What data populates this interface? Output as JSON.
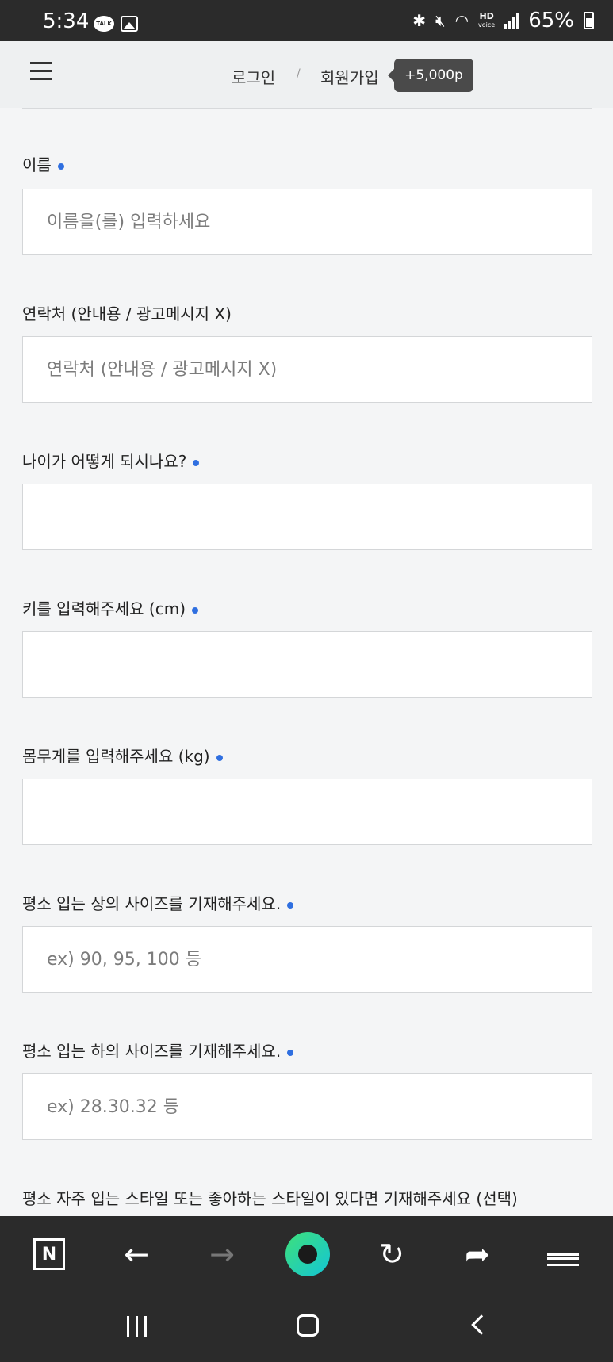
{
  "status_bar": {
    "time": "5:34",
    "talk_icon": "TALK",
    "hd_label": "HD",
    "voice_label": "voice",
    "battery": "65%"
  },
  "header": {
    "login": "로그인",
    "separator": "/",
    "signup": "회원가입",
    "points": "+5,000p"
  },
  "form": {
    "fields": [
      {
        "label": "이름",
        "required": true,
        "placeholder": "이름을(를) 입력하세요",
        "value": ""
      },
      {
        "label": "연락처 (안내용 / 광고메시지 X)",
        "required": false,
        "placeholder": "연락처 (안내용 / 광고메시지 X)",
        "value": ""
      },
      {
        "label": "나이가 어떻게 되시나요?",
        "required": true,
        "placeholder": "",
        "value": ""
      },
      {
        "label": "키를 입력해주세요 (cm)",
        "required": true,
        "placeholder": "",
        "value": ""
      },
      {
        "label": "몸무게를 입력해주세요 (kg)",
        "required": true,
        "placeholder": "",
        "value": ""
      },
      {
        "label": "평소 입는 상의 사이즈를 기재해주세요.",
        "required": true,
        "placeholder": "ex) 90, 95, 100 등",
        "value": ""
      },
      {
        "label": "평소 입는 하의 사이즈를 기재해주세요.",
        "required": true,
        "placeholder": "ex) 28.30.32 등",
        "value": ""
      }
    ],
    "last_label": "평소 자주 입는 스타일 또는 좋아하는 스타일이 있다면 기재해주세요 (선택)"
  },
  "toolbar": {
    "n_icon": "N",
    "back": "←",
    "forward": "→",
    "reload": "↻",
    "share": "➦"
  },
  "accent_color": "#2f6fe0"
}
